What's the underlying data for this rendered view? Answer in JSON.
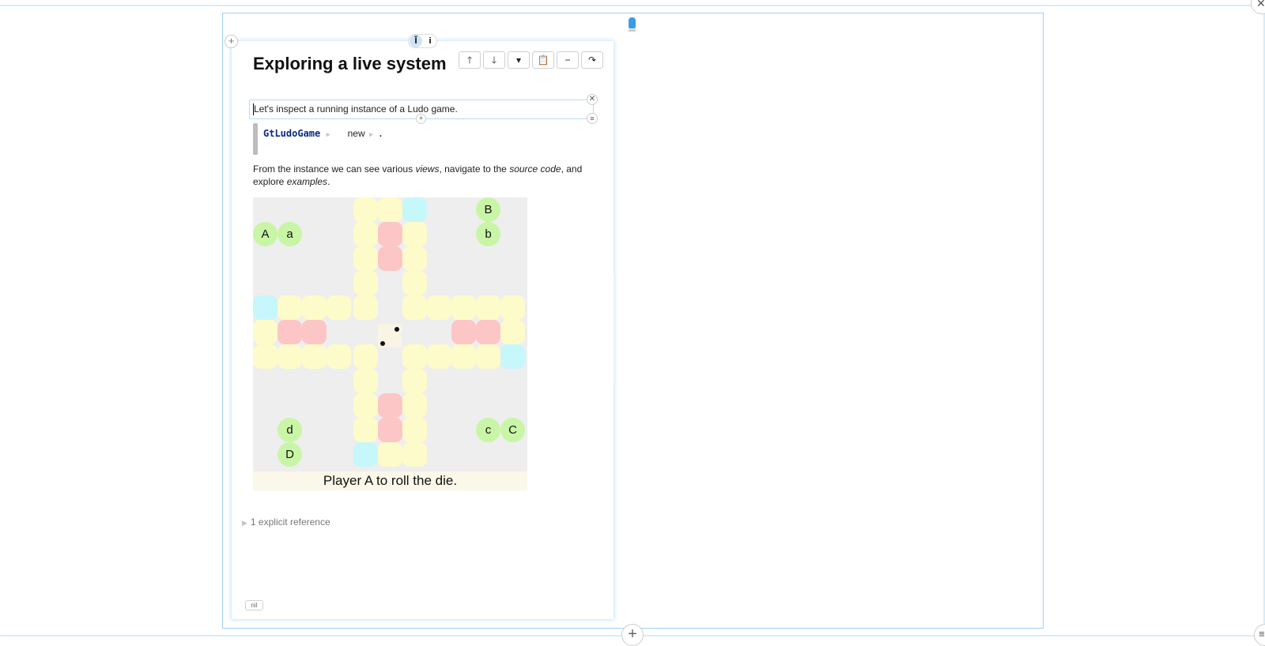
{
  "page": {
    "title": "Exploring a live system",
    "toolbar": [
      {
        "name": "move-up-button",
        "glyph": "🡑"
      },
      {
        "name": "move-down-button",
        "glyph": "🡓"
      },
      {
        "name": "more-dropdown-button",
        "glyph": "▾"
      },
      {
        "name": "clipboard-button",
        "glyph": "📋"
      },
      {
        "name": "remove-button",
        "glyph": "−"
      },
      {
        "name": "share-button",
        "glyph": "↷"
      }
    ],
    "tab_toggles": [
      "Ĭ",
      "i"
    ],
    "text_snippet": "Let's inspect a running instance of a Ludo game.",
    "code": {
      "class": "GtLudoGame",
      "message": "new",
      "terminator": "."
    },
    "paragraph": {
      "p1": "From the instance we can see various ",
      "v1": "views",
      "p2": ", navigate to the ",
      "v2": "source code",
      "p3": ", and explore ",
      "v3": "examples",
      "p4": "."
    },
    "references_label": "1 explicit reference",
    "nil_label": "nil"
  },
  "controls": {
    "world_close": "✕",
    "world_menu": "≡",
    "world_add": "+",
    "page_add": "+",
    "snippet_close": "✕",
    "snippet_add": "+",
    "snippet_menu": "≡"
  },
  "ludo": {
    "status": "Player A to roll the die.",
    "die_value": 2,
    "colors": {
      "track": "#fdfbc9",
      "home": "#fdc6c6",
      "start": "#c6f7fb",
      "token": "#c9f6a6",
      "board": "#eeeeee"
    },
    "tokens": [
      "A",
      "a",
      "B",
      "b",
      "C",
      "c",
      "D",
      "d"
    ]
  }
}
